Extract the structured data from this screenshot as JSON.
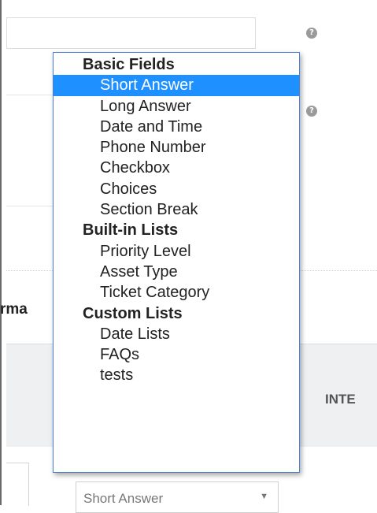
{
  "field_type_select": {
    "value": "Short Answer",
    "arrow": "▼"
  },
  "partial_label": "rma",
  "table_header": {
    "partial_text": "INTE"
  },
  "help_icon_glyph": "?",
  "dropdown": {
    "groups": [
      {
        "label": "Basic Fields",
        "options": [
          {
            "label": "Short Answer",
            "selected": true
          },
          {
            "label": "Long Answer"
          },
          {
            "label": "Date and Time"
          },
          {
            "label": "Phone Number"
          },
          {
            "label": "Checkbox"
          },
          {
            "label": "Choices"
          },
          {
            "label": "Section Break"
          }
        ]
      },
      {
        "label": "Built-in Lists",
        "options": [
          {
            "label": "Priority Level"
          },
          {
            "label": "Asset Type"
          },
          {
            "label": "Ticket Category"
          }
        ]
      },
      {
        "label": "Custom Lists",
        "options": [
          {
            "label": "Date Lists"
          },
          {
            "label": "FAQs"
          },
          {
            "label": "tests"
          }
        ]
      }
    ]
  },
  "colors": {
    "selected_bg": "#1e90ff",
    "dropdown_border": "#4a7fd6",
    "header_bg": "#eef0f1"
  }
}
